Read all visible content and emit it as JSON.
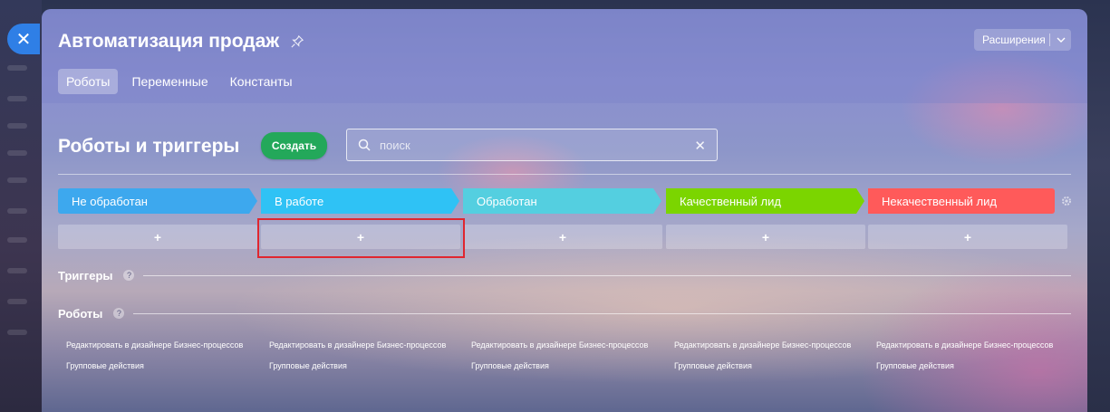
{
  "title": "Автоматизация продаж",
  "extensions_label": "Расширения",
  "tabs": [
    {
      "label": "Роботы",
      "active": true
    },
    {
      "label": "Переменные"
    },
    {
      "label": "Константы"
    }
  ],
  "section_title": "Роботы и триггеры",
  "create_label": "Создать",
  "search": {
    "placeholder": "поиск",
    "value": ""
  },
  "stages": [
    {
      "label": "Не обработан",
      "color": "#3da8ee"
    },
    {
      "label": "В работе",
      "color": "#2fc2f5"
    },
    {
      "label": "Обработан",
      "color": "#54cfe0"
    },
    {
      "label": "Качественный лид",
      "color": "#7bd500"
    },
    {
      "label": "Некачественный лид",
      "color": "#ff5a5a"
    }
  ],
  "add_label": "+",
  "triggers_label": "Триггеры",
  "robots_label": "Роботы",
  "help_label": "?",
  "column_links": {
    "edit": "Редактировать в дизайнере Бизнес-процессов",
    "group": "Групповые действия"
  },
  "colors": {
    "create_button": "#23a85a",
    "close_button": "#2f7fe6",
    "highlight": "#e0262f"
  }
}
